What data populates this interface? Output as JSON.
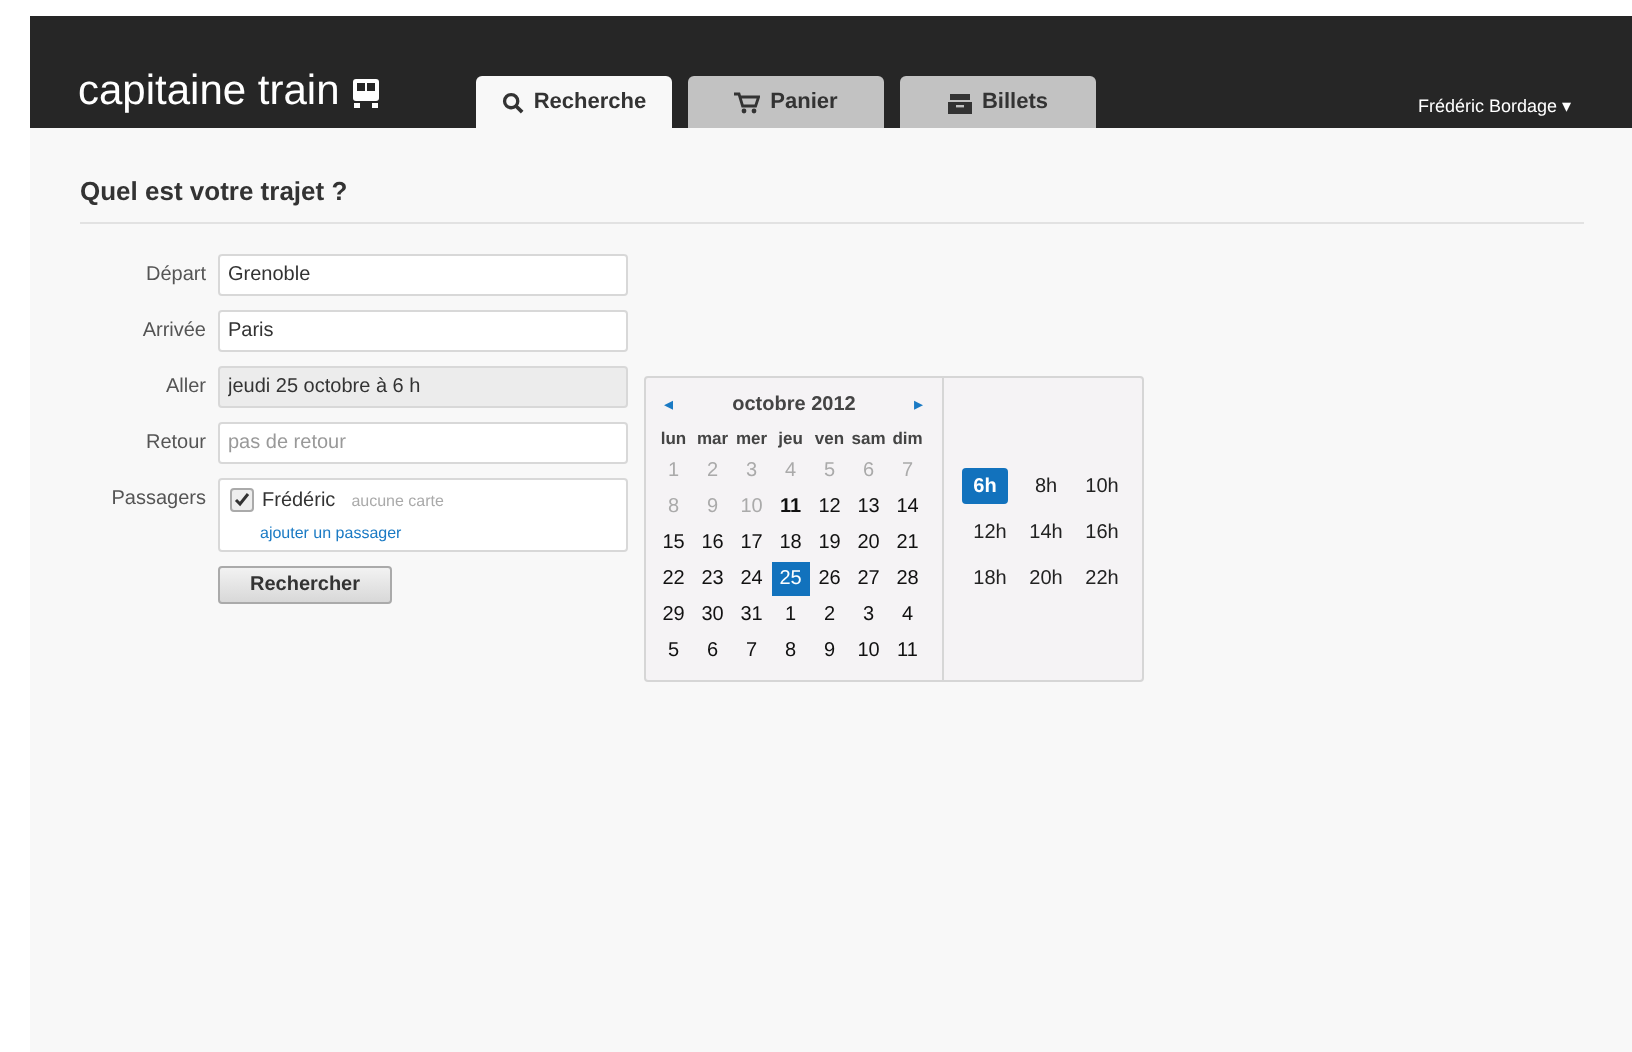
{
  "header": {
    "logo": "capitaine train",
    "tabs": [
      {
        "label": "Recherche",
        "kind": "search",
        "selected": true
      },
      {
        "label": "Panier",
        "kind": "cart",
        "selected": false
      },
      {
        "label": "Billets",
        "kind": "tickets",
        "selected": false
      }
    ],
    "user": "Frédéric Bordage ▾"
  },
  "form": {
    "title": "Quel est votre trajet ?",
    "fields": [
      {
        "label": "Départ",
        "value": "Grenoble",
        "kind": "text"
      },
      {
        "label": "Arrivée",
        "value": "Paris",
        "kind": "text"
      },
      {
        "label": "Aller",
        "value": "jeudi 25 octobre à 6 h",
        "kind": "readonly"
      },
      {
        "label": "Retour",
        "placeholder": "pas de retour",
        "kind": "text"
      }
    ],
    "passengers": {
      "label": "Passagers",
      "items": [
        {
          "name": "Frédéric",
          "card": "aucune carte",
          "checked": true
        }
      ],
      "add_link": "ajouter un passager"
    },
    "submit": "Rechercher"
  },
  "calendar": {
    "prev": "◂",
    "month": "octobre 2012",
    "next": "▸",
    "weekdays": [
      "lun",
      "mar",
      "mer",
      "jeu",
      "ven",
      "sam",
      "dim"
    ],
    "days": [
      {
        "label": "1",
        "kind": "past",
        "selected": false
      },
      {
        "label": "2",
        "kind": "past",
        "selected": false
      },
      {
        "label": "3",
        "kind": "past",
        "selected": false
      },
      {
        "label": "4",
        "kind": "past",
        "selected": false
      },
      {
        "label": "5",
        "kind": "past",
        "selected": false
      },
      {
        "label": "6",
        "kind": "past",
        "selected": false
      },
      {
        "label": "7",
        "kind": "past",
        "selected": false
      },
      {
        "label": "8",
        "kind": "past",
        "selected": false
      },
      {
        "label": "9",
        "kind": "past",
        "selected": false
      },
      {
        "label": "10",
        "kind": "past",
        "selected": false
      },
      {
        "label": "11",
        "kind": "today",
        "selected": false
      },
      {
        "label": "12",
        "kind": "normal",
        "selected": false
      },
      {
        "label": "13",
        "kind": "normal",
        "selected": false
      },
      {
        "label": "14",
        "kind": "normal",
        "selected": false
      },
      {
        "label": "15",
        "kind": "normal",
        "selected": false
      },
      {
        "label": "16",
        "kind": "normal",
        "selected": false
      },
      {
        "label": "17",
        "kind": "normal",
        "selected": false
      },
      {
        "label": "18",
        "kind": "normal",
        "selected": false
      },
      {
        "label": "19",
        "kind": "normal",
        "selected": false
      },
      {
        "label": "20",
        "kind": "normal",
        "selected": false
      },
      {
        "label": "21",
        "kind": "normal",
        "selected": false
      },
      {
        "label": "22",
        "kind": "normal",
        "selected": false
      },
      {
        "label": "23",
        "kind": "normal",
        "selected": false
      },
      {
        "label": "24",
        "kind": "normal",
        "selected": false
      },
      {
        "label": "25",
        "kind": "normal",
        "selected": true
      },
      {
        "label": "26",
        "kind": "normal",
        "selected": false
      },
      {
        "label": "27",
        "kind": "normal",
        "selected": false
      },
      {
        "label": "28",
        "kind": "normal",
        "selected": false
      },
      {
        "label": "29",
        "kind": "normal",
        "selected": false
      },
      {
        "label": "30",
        "kind": "normal",
        "selected": false
      },
      {
        "label": "31",
        "kind": "normal",
        "selected": false
      },
      {
        "label": "1",
        "kind": "normal",
        "selected": false
      },
      {
        "label": "2",
        "kind": "normal",
        "selected": false
      },
      {
        "label": "3",
        "kind": "normal",
        "selected": false
      },
      {
        "label": "4",
        "kind": "normal",
        "selected": false
      },
      {
        "label": "5",
        "kind": "normal",
        "selected": false
      },
      {
        "label": "6",
        "kind": "normal",
        "selected": false
      },
      {
        "label": "7",
        "kind": "normal",
        "selected": false
      },
      {
        "label": "8",
        "kind": "normal",
        "selected": false
      },
      {
        "label": "9",
        "kind": "normal",
        "selected": false
      },
      {
        "label": "10",
        "kind": "normal",
        "selected": false
      },
      {
        "label": "11",
        "kind": "normal",
        "selected": false
      }
    ],
    "hours": [
      {
        "label": "6h",
        "selected": true
      },
      {
        "label": "8h",
        "selected": false
      },
      {
        "label": "10h",
        "selected": false
      },
      {
        "label": "12h",
        "selected": false
      },
      {
        "label": "14h",
        "selected": false
      },
      {
        "label": "16h",
        "selected": false
      },
      {
        "label": "18h",
        "selected": false
      },
      {
        "label": "20h",
        "selected": false
      },
      {
        "label": "22h",
        "selected": false
      }
    ]
  }
}
